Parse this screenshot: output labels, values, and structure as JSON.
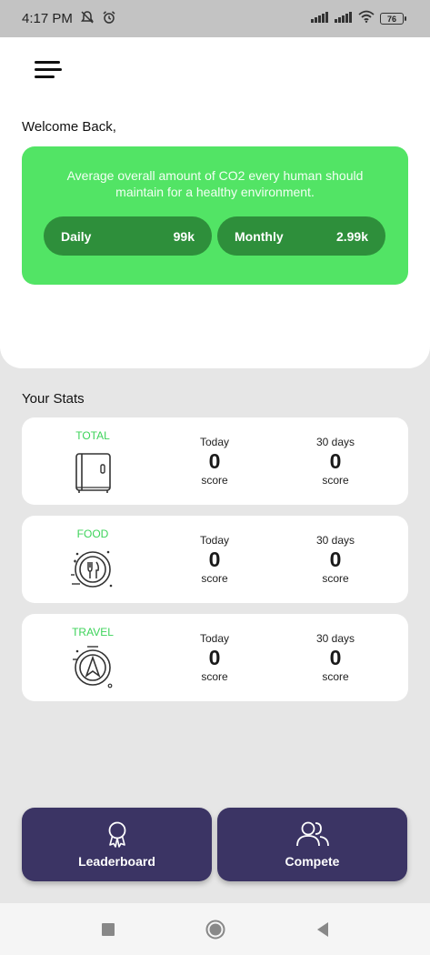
{
  "status_bar": {
    "time": "4:17 PM",
    "battery": "76",
    "icons": [
      "mute-icon",
      "alarm-icon",
      "signal-icon",
      "signal-icon",
      "wifi-icon",
      "battery-icon"
    ]
  },
  "header": {
    "menu_icon": "hamburger-menu-icon",
    "welcome": "Welcome Back,"
  },
  "co2_card": {
    "description": "Average overall amount of CO2 every human should maintain for a healthy environment.",
    "daily_label": "Daily",
    "daily_value": "99k",
    "monthly_label": "Monthly",
    "monthly_value": "2.99k"
  },
  "stats": {
    "title": "Your Stats",
    "cards": [
      {
        "label": "TOTAL",
        "icon": "fridge-icon",
        "today_label": "Today",
        "today_value": "0",
        "today_unit": "score",
        "days_label": "30 days",
        "days_value": "0",
        "days_unit": "score"
      },
      {
        "label": "FOOD",
        "icon": "food-plate-icon",
        "today_label": "Today",
        "today_value": "0",
        "today_unit": "score",
        "days_label": "30 days",
        "days_value": "0",
        "days_unit": "score"
      },
      {
        "label": "TRAVEL",
        "icon": "compass-icon",
        "today_label": "Today",
        "today_value": "0",
        "today_unit": "score",
        "days_label": "30 days",
        "days_value": "0",
        "days_unit": "score"
      }
    ]
  },
  "actions": {
    "leaderboard_label": "Leaderboard",
    "leaderboard_icon": "award-ribbon-icon",
    "compete_label": "Compete",
    "compete_icon": "users-icon"
  },
  "nav": {
    "items": [
      "recent-apps-icon",
      "home-icon",
      "back-icon"
    ]
  },
  "colors": {
    "accent_green": "#52e465",
    "pill_green": "#2e8f3b",
    "label_green": "#3dd35a",
    "button_purple": "#3b3464",
    "background": "#e6e6e6"
  }
}
